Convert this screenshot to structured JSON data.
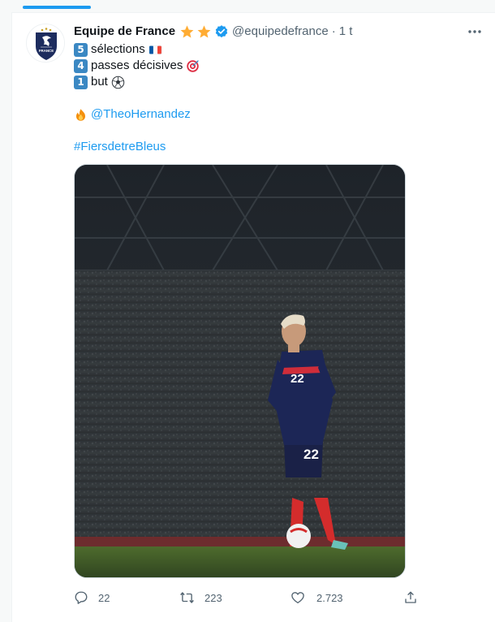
{
  "tweet": {
    "display_name": "Equipe de France",
    "handle": "@equipedefrance",
    "separator": "·",
    "time": "1 t",
    "lines": [
      {
        "number": "5",
        "text": "sélections",
        "emoji": "france-flag-icon"
      },
      {
        "number": "4",
        "text": "passes décisives",
        "emoji": "target-icon"
      },
      {
        "number": "1",
        "text": "but",
        "emoji": "soccer-ball-icon"
      }
    ],
    "mention_emoji": "fire-icon",
    "mention": "@TheoHernandez",
    "hashtag": "#FiersdetreBleus",
    "avatar_logo_text": "FRANCE"
  },
  "media": {
    "description_icon": "photo-player-22",
    "jersey_number": "22"
  },
  "actions": {
    "reply_count": "22",
    "retweet_count": "223",
    "like_count": "2.723"
  },
  "colors": {
    "accent": "#1d9bf0",
    "secondary_text": "#536471",
    "keycap": "#3b88c3",
    "star": "#ffac33"
  }
}
